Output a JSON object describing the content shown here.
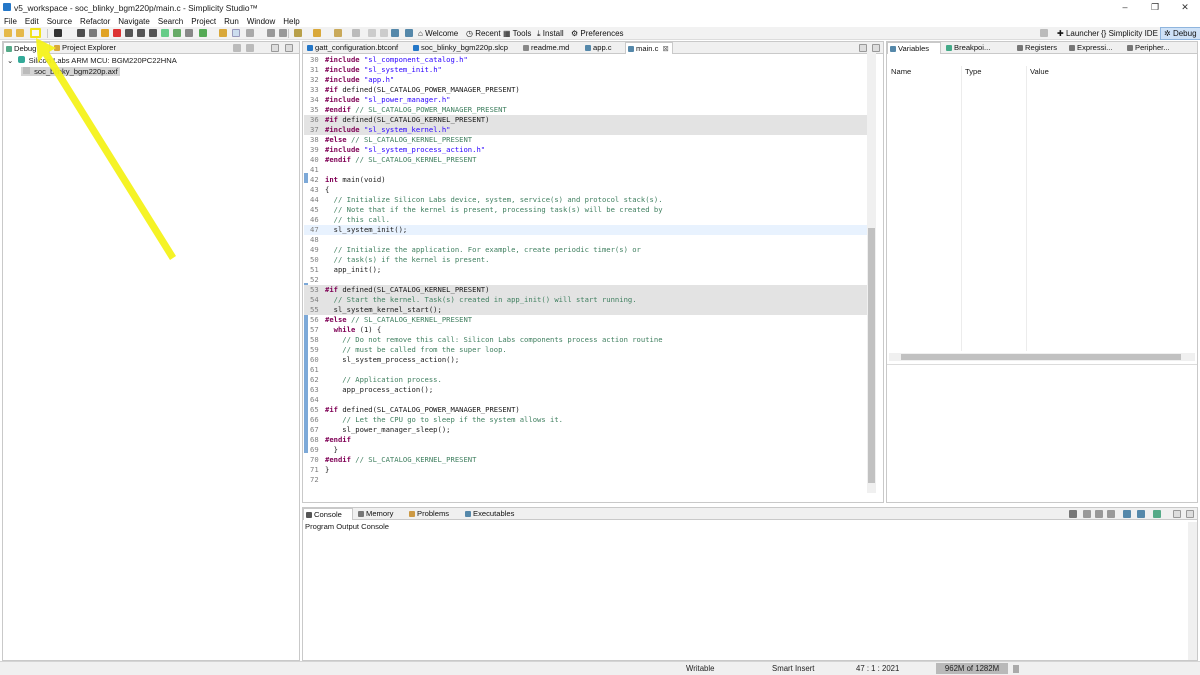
{
  "window": {
    "title": "v5_workspace - soc_blinky_bgm220p/main.c - Simplicity Studio™",
    "minimize": "–",
    "restore": "❐",
    "close": "✕"
  },
  "menu": [
    "File",
    "Edit",
    "Source",
    "Refactor",
    "Navigate",
    "Search",
    "Project",
    "Run",
    "Window",
    "Help"
  ],
  "toolbar": {
    "welcome": "Welcome",
    "recent": "Recent",
    "tools": "Tools",
    "install": "Install",
    "preferences": "Preferences",
    "launcher": "Launcher",
    "simplicity_ide": "Simplicity IDE",
    "debug": "Debug"
  },
  "left_panel": {
    "tabs": [
      "Debug",
      "Project Explorer"
    ],
    "tree": {
      "root": "Silicon Labs ARM MCU: BGM220PC22HNA",
      "child": "soc_blinky_bgm220p.axf"
    }
  },
  "editor": {
    "tabs": [
      "gatt_configuration.btconf",
      "soc_blinky_bgm220p.slcp",
      "readme.md",
      "app.c",
      "main.c"
    ],
    "lines": [
      {
        "n": "30",
        "parts": [
          [
            "pp",
            "#include "
          ],
          [
            "str",
            "\"sl_component_catalog.h\""
          ]
        ]
      },
      {
        "n": "31",
        "parts": [
          [
            "pp",
            "#include "
          ],
          [
            "str",
            "\"sl_system_init.h\""
          ]
        ]
      },
      {
        "n": "32",
        "parts": [
          [
            "pp",
            "#include "
          ],
          [
            "str",
            "\"app.h\""
          ]
        ]
      },
      {
        "n": "33",
        "parts": [
          [
            "pp",
            "#if "
          ],
          [
            "",
            "defined(SL_CATALOG_POWER_MANAGER_PRESENT)"
          ]
        ]
      },
      {
        "n": "34",
        "parts": [
          [
            "pp",
            "#include "
          ],
          [
            "str",
            "\"sl_power_manager.h\""
          ]
        ]
      },
      {
        "n": "35",
        "parts": [
          [
            "pp",
            "#endif "
          ],
          [
            "cmt",
            "// SL_CATALOG_POWER_MANAGER_PRESENT"
          ]
        ]
      },
      {
        "n": "36",
        "hl": true,
        "parts": [
          [
            "pp",
            "#if "
          ],
          [
            "",
            "defined(SL_CATALOG_KERNEL_PRESENT)"
          ]
        ]
      },
      {
        "n": "37",
        "hl": true,
        "parts": [
          [
            "pp",
            "#include "
          ],
          [
            "str",
            "\"sl_system_kernel.h\""
          ]
        ]
      },
      {
        "n": "38",
        "parts": [
          [
            "pp",
            "#else "
          ],
          [
            "cmt",
            "// SL_CATALOG_KERNEL_PRESENT"
          ]
        ]
      },
      {
        "n": "39",
        "parts": [
          [
            "pp",
            "#include "
          ],
          [
            "str",
            "\"sl_system_process_action.h\""
          ]
        ]
      },
      {
        "n": "40",
        "parts": [
          [
            "pp",
            "#endif "
          ],
          [
            "cmt",
            "// SL_CATALOG_KERNEL_PRESENT"
          ]
        ]
      },
      {
        "n": "41",
        "parts": []
      },
      {
        "n": "42",
        "parts": [
          [
            "kw",
            "int "
          ],
          [
            "",
            "main(void)"
          ]
        ]
      },
      {
        "n": "43",
        "parts": [
          [
            "",
            "{"
          ]
        ]
      },
      {
        "n": "44",
        "parts": [
          [
            "cmt",
            "  // Initialize Silicon Labs device, system, service(s) and protocol stack(s)."
          ]
        ]
      },
      {
        "n": "45",
        "parts": [
          [
            "cmt",
            "  // Note that if the kernel is present, processing task(s) will be created by"
          ]
        ]
      },
      {
        "n": "46",
        "parts": [
          [
            "cmt",
            "  // this call."
          ]
        ]
      },
      {
        "n": "47",
        "cur": true,
        "parts": [
          [
            "",
            "  sl_system_init();"
          ]
        ]
      },
      {
        "n": "48",
        "parts": []
      },
      {
        "n": "49",
        "parts": [
          [
            "cmt",
            "  // Initialize the application. For example, create periodic timer(s) or"
          ]
        ]
      },
      {
        "n": "50",
        "parts": [
          [
            "cmt",
            "  // task(s) if the kernel is present."
          ]
        ]
      },
      {
        "n": "51",
        "parts": [
          [
            "",
            "  app_init();"
          ]
        ]
      },
      {
        "n": "52",
        "parts": []
      },
      {
        "n": "53",
        "hl": true,
        "parts": [
          [
            "pp",
            "#if "
          ],
          [
            "",
            "defined(SL_CATALOG_KERNEL_PRESENT)"
          ]
        ]
      },
      {
        "n": "54",
        "hl": true,
        "parts": [
          [
            "cmt",
            "  // Start the kernel. Task(s) created in app_init() will start running."
          ]
        ]
      },
      {
        "n": "55",
        "hl": true,
        "parts": [
          [
            "",
            "  sl_system_kernel_start();"
          ]
        ]
      },
      {
        "n": "56",
        "parts": [
          [
            "pp",
            "#else "
          ],
          [
            "cmt",
            "// SL_CATALOG_KERNEL_PRESENT"
          ]
        ]
      },
      {
        "n": "57",
        "parts": [
          [
            "kw",
            "  while "
          ],
          [
            "",
            "(1) {"
          ]
        ]
      },
      {
        "n": "58",
        "parts": [
          [
            "cmt",
            "    // Do not remove this call: Silicon Labs components process action routine"
          ]
        ]
      },
      {
        "n": "59",
        "parts": [
          [
            "cmt",
            "    // must be called from the super loop."
          ]
        ]
      },
      {
        "n": "60",
        "parts": [
          [
            "",
            "    sl_system_process_action();"
          ]
        ]
      },
      {
        "n": "61",
        "parts": []
      },
      {
        "n": "62",
        "parts": [
          [
            "cmt",
            "    // Application process."
          ]
        ]
      },
      {
        "n": "63",
        "parts": [
          [
            "",
            "    app_process_action();"
          ]
        ]
      },
      {
        "n": "64",
        "parts": []
      },
      {
        "n": "65",
        "parts": [
          [
            "pp",
            "#if "
          ],
          [
            "",
            "defined(SL_CATALOG_POWER_MANAGER_PRESENT)"
          ]
        ]
      },
      {
        "n": "66",
        "parts": [
          [
            "cmt",
            "    // Let the CPU go to sleep if the system allows it."
          ]
        ]
      },
      {
        "n": "67",
        "parts": [
          [
            "",
            "    sl_power_manager_sleep();"
          ]
        ]
      },
      {
        "n": "68",
        "parts": [
          [
            "pp",
            "#endif"
          ]
        ]
      },
      {
        "n": "69",
        "parts": [
          [
            "",
            "  }"
          ]
        ]
      },
      {
        "n": "70",
        "parts": [
          [
            "pp",
            "#endif "
          ],
          [
            "cmt",
            "// SL_CATALOG_KERNEL_PRESENT"
          ]
        ]
      },
      {
        "n": "71",
        "parts": [
          [
            "",
            "}"
          ]
        ]
      },
      {
        "n": "72",
        "parts": []
      }
    ]
  },
  "right_panel": {
    "tabs": [
      "Variables",
      "Breakpoi...",
      "Registers",
      "Expressi...",
      "Peripher..."
    ],
    "columns": [
      "Name",
      "Type",
      "Value"
    ]
  },
  "bottom_panel": {
    "tabs": [
      "Console",
      "Memory",
      "Problems",
      "Executables"
    ],
    "console_title": "Program Output Console"
  },
  "status": {
    "writable": "Writable",
    "insert": "Smart Insert",
    "position": "47 : 1 : 2021",
    "memory": "962M of 1282M"
  },
  "colors": {
    "annotation_arrow": "#f4f21a",
    "accent": "#2477c8"
  }
}
